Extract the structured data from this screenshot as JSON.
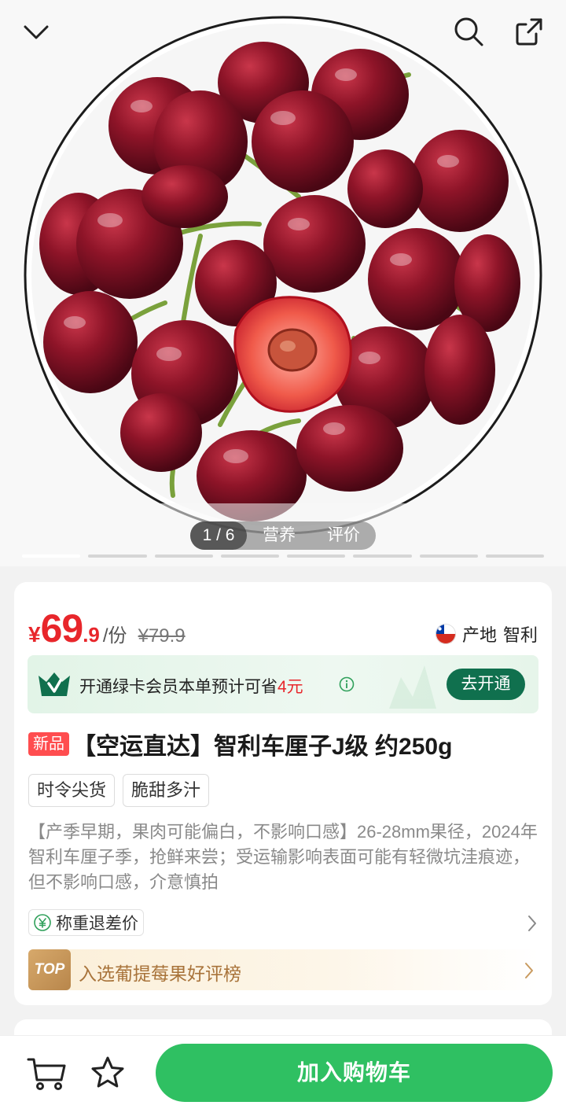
{
  "header": {
    "collapse_icon": "chevron-down-icon",
    "search_icon": "search-icon",
    "share_icon": "share-icon"
  },
  "gallery": {
    "counter": "1 / 6",
    "tabs": [
      "营养",
      "评价"
    ],
    "total_slides": 8,
    "active_slide": 0
  },
  "price": {
    "currency": "¥",
    "integer": "69",
    "decimal": ".9",
    "unit": "/份",
    "original": "¥79.9"
  },
  "origin": {
    "label": "产地",
    "value": "智利"
  },
  "member": {
    "text_before": "开通绿卡会员本单预计可省",
    "amount": "4元",
    "button": "去开通"
  },
  "product": {
    "badge": "新品",
    "title": "【空运直达】智利车厘子J级 约250g",
    "tags": [
      "时令尖货",
      "脆甜多汁"
    ],
    "description": "【产季早期，果肉可能偏白，不影响口感】26-28mm果径，2024年智利车厘子季，抢鲜来尝；受运输影响表面可能有轻微坑洼痕迹，但不影响口感，介意慎拍"
  },
  "refund": {
    "label": "称重退差价"
  },
  "ranking": {
    "badge": "TOP",
    "text": "入选葡提莓果好评榜"
  },
  "bottom": {
    "add_to_cart": "加入购物车"
  },
  "colors": {
    "price_red": "#e8262b",
    "brand_green": "#2fc062",
    "member_green": "#10704e",
    "rank_gold": "#a8733a"
  }
}
